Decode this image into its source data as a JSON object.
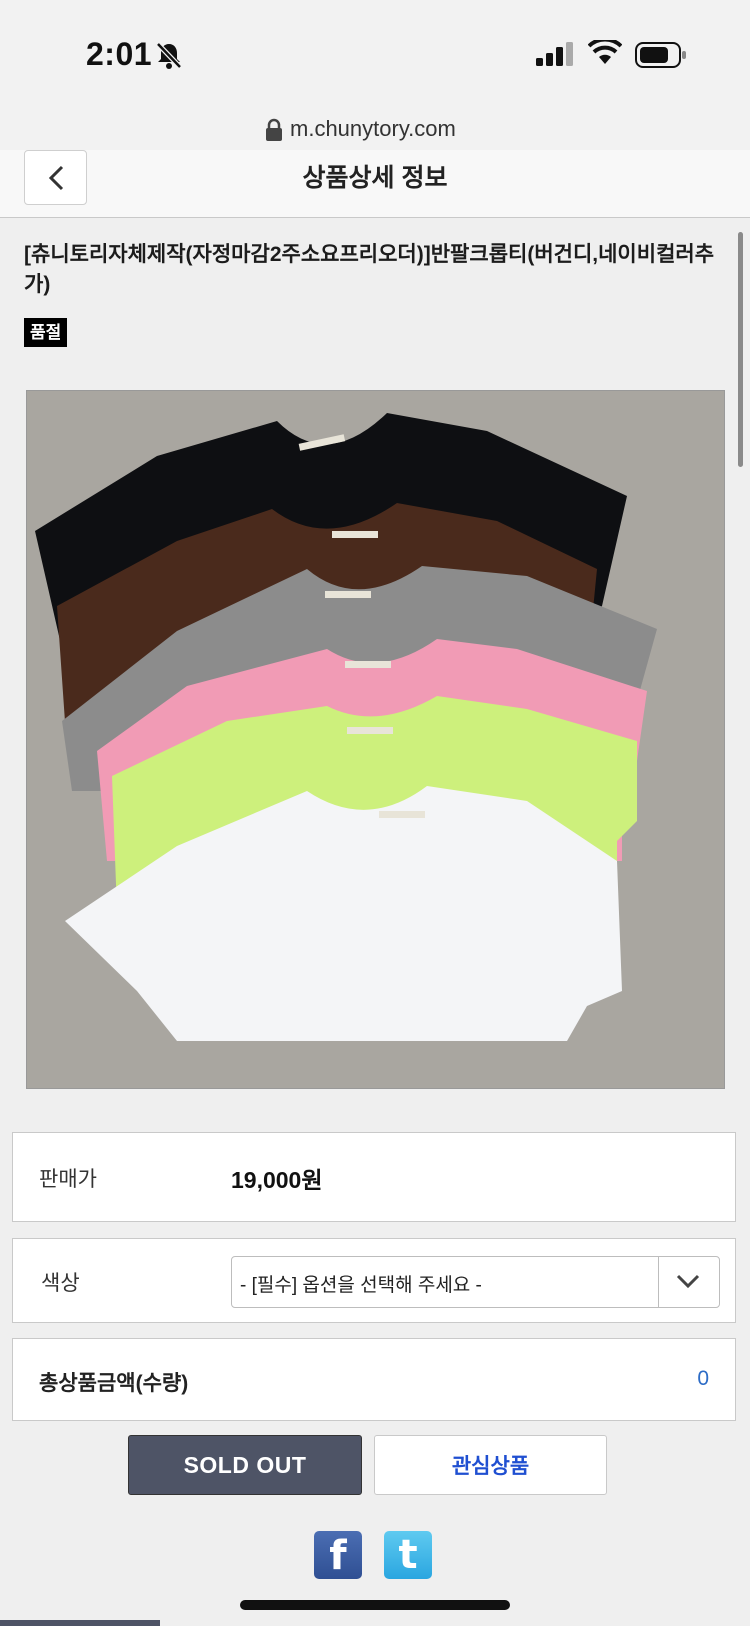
{
  "status_bar": {
    "time": "2:01",
    "icons": [
      "bell-slash-icon",
      "signal-icon",
      "wifi-icon",
      "battery-icon"
    ]
  },
  "browser": {
    "url": "m.chunytory.com"
  },
  "header": {
    "title": "상품상세 정보",
    "back_icon": "chevron-left-icon"
  },
  "product": {
    "name": "[츄니토리자체제작(자정마감2주소요프리오더)]반팔크롭티(버건디,네이비컬러추가)",
    "badge": "품절",
    "image_desc_colors": [
      "#0c0d10",
      "#4a2a1c",
      "#8a8a8a",
      "#f09ab3",
      "#c9f07a",
      "#f4f5f7"
    ]
  },
  "price": {
    "label": "판매가",
    "value": "19,000원"
  },
  "color_option": {
    "label": "색상",
    "selected": "- [필수] 옵션을 선택해 주세요 -"
  },
  "total": {
    "label": "총상품금액(수량)",
    "value": "0"
  },
  "buttons": {
    "sold_out": "SOLD OUT",
    "wishlist": "관심상품"
  },
  "share": {
    "facebook": "f",
    "twitter": "t"
  },
  "colors": {
    "accent_blue": "#2d6cc6",
    "wish_blue": "#1f4fd1",
    "sold_out_bg": "#4e5466"
  }
}
